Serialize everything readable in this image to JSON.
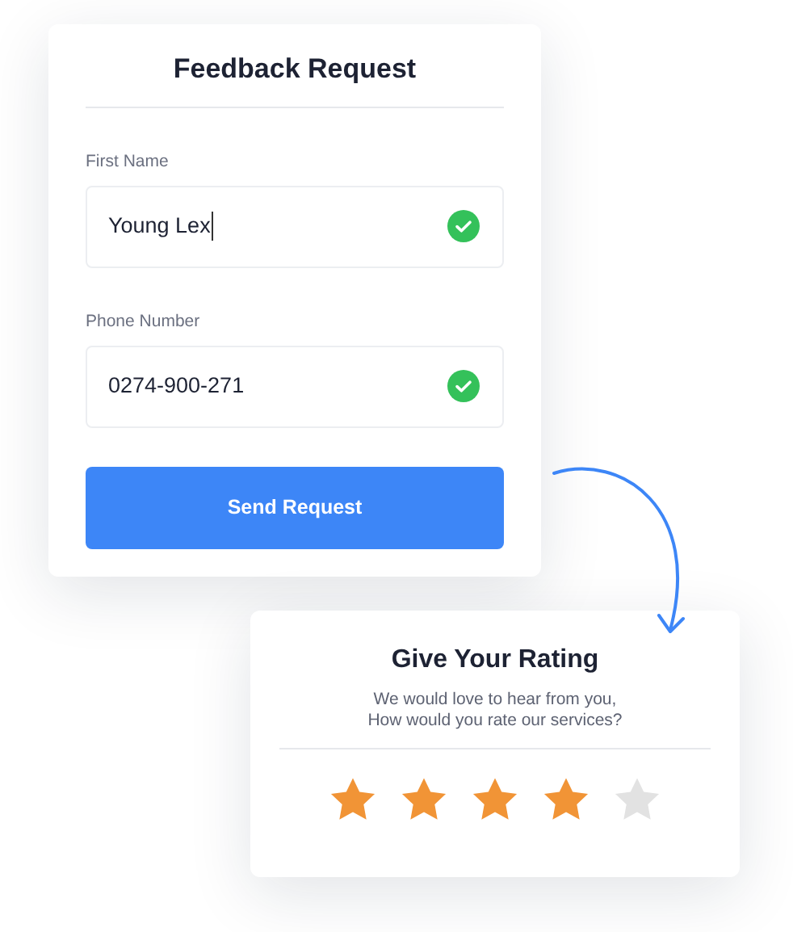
{
  "feedback_form": {
    "title": "Feedback Request",
    "fields": [
      {
        "label": "First Name",
        "value": "Young Lex",
        "valid": true,
        "focused": true
      },
      {
        "label": "Phone Number",
        "value": "0274-900-271",
        "valid": true,
        "focused": false
      }
    ],
    "submit_button": "Send Request"
  },
  "rating_card": {
    "title": "Give Your Rating",
    "message": [
      "We would love to hear from you,",
      "How would you rate our services?"
    ],
    "stars": 4
  }
}
